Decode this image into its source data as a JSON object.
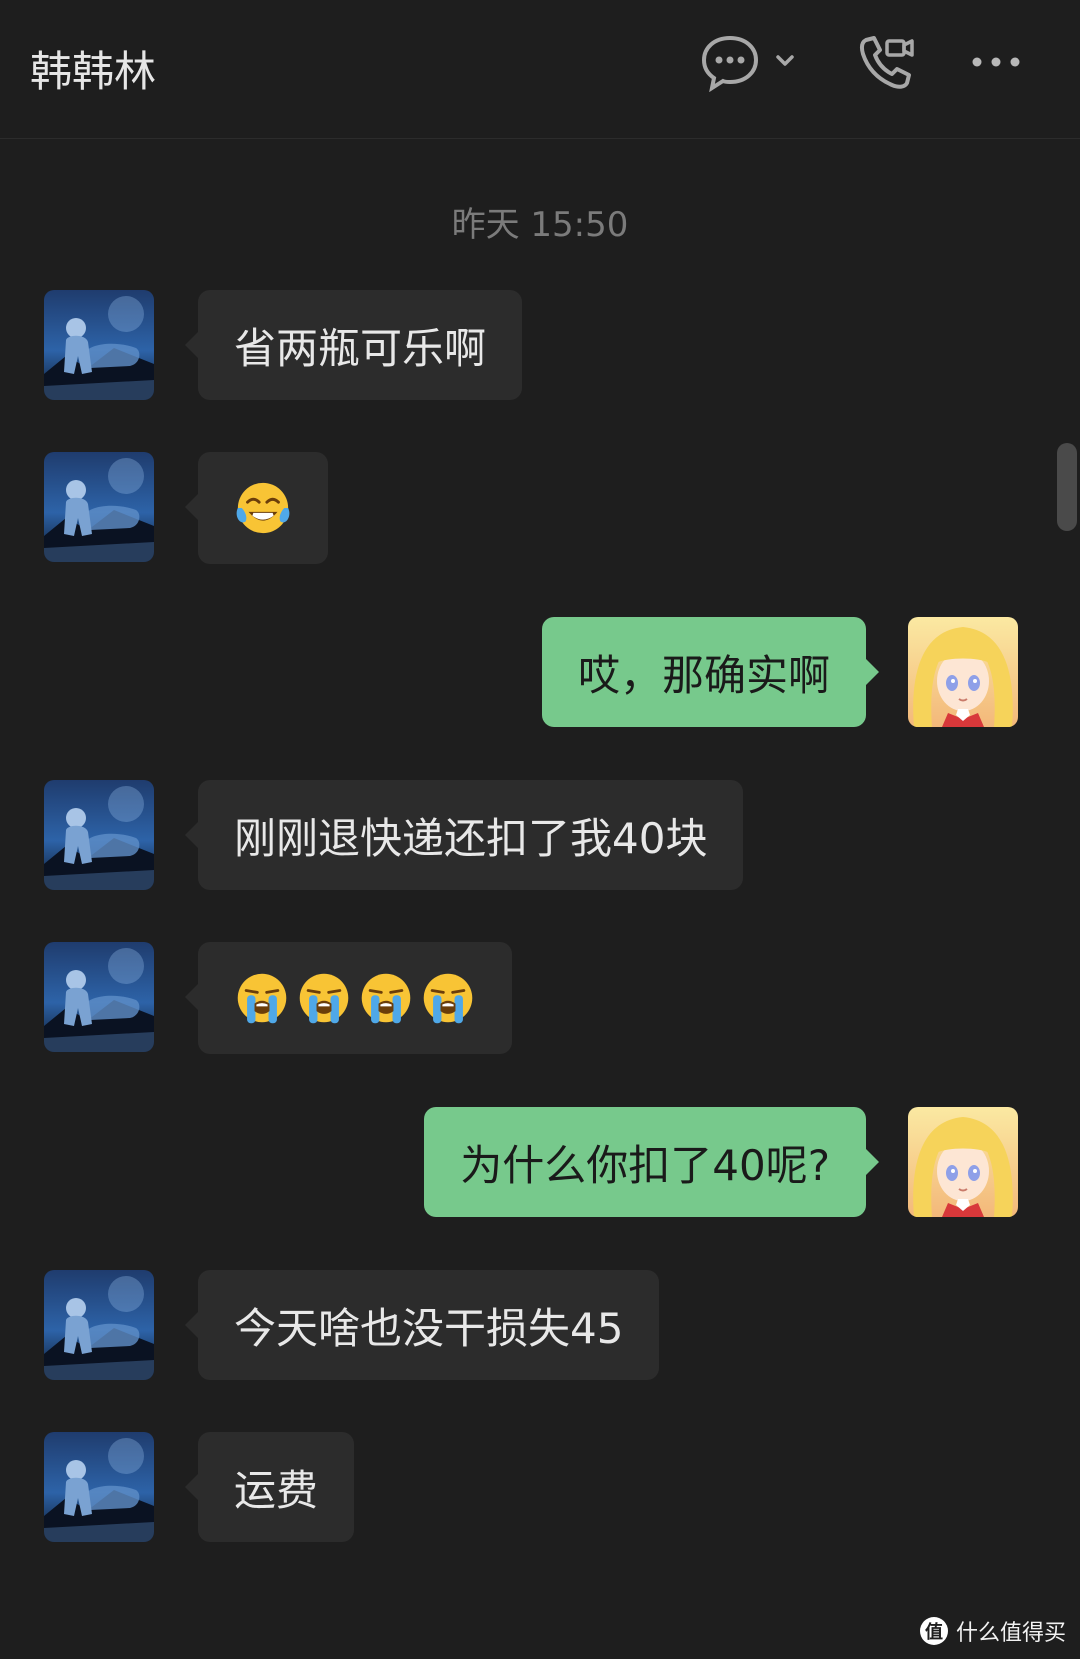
{
  "header": {
    "title": "韩韩林"
  },
  "timestamp": "昨天 15:50",
  "messages": [
    {
      "direction": "in",
      "type": "text",
      "text": "省两瓶可乐啊"
    },
    {
      "direction": "in",
      "type": "emoji",
      "emojis": [
        "tears-of-joy-emoji"
      ]
    },
    {
      "direction": "out",
      "type": "text",
      "text": "哎，那确实啊"
    },
    {
      "direction": "in",
      "type": "text",
      "text": "刚刚退快递还扣了我40块"
    },
    {
      "direction": "in",
      "type": "emoji",
      "emojis": [
        "crying-emoji",
        "crying-emoji",
        "crying-emoji",
        "crying-emoji"
      ]
    },
    {
      "direction": "out",
      "type": "text",
      "text": "为什么你扣了40呢?"
    },
    {
      "direction": "in",
      "type": "text",
      "text": "今天啥也没干损失45"
    },
    {
      "direction": "in",
      "type": "text",
      "text": "运费"
    }
  ],
  "watermark": {
    "logo": "值",
    "text": "什么值得买"
  },
  "colors": {
    "background": "#1e1e1e",
    "incoming_bubble": "#2c2c2c",
    "outgoing_bubble": "#77c98c",
    "timestamp": "#7b7b7b"
  }
}
